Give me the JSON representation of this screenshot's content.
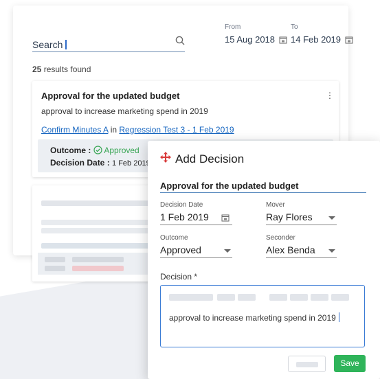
{
  "search": {
    "label": "Search"
  },
  "dates": {
    "from_label": "From",
    "from_value": "15 Aug 2018",
    "to_label": "To",
    "to_value": "14 Feb 2019"
  },
  "results": {
    "count": "25",
    "text": " results found"
  },
  "item": {
    "title": "Approval for the updated budget",
    "description": "approval to increase marketing spend in 2019",
    "link1": "Confirm Minutes A",
    "link_sep": " in ",
    "link2": "Regression Test 3 - 1 Feb 2019",
    "outcome_key": "Outcome : ",
    "outcome_value": "Approved",
    "date_key": "Decision Date : ",
    "date_value": "1 Feb 2019"
  },
  "modal": {
    "title": "Add Decision",
    "field_title": "Approval for the updated budget",
    "decision_date_label": "Decision Date",
    "decision_date_value": "1 Feb 2019",
    "mover_label": "Mover",
    "mover_value": "Ray Flores",
    "outcome_label": "Outcome",
    "outcome_value": "Approved",
    "seconder_label": "Seconder",
    "seconder_value": "Alex Benda",
    "decision_label": "Decision *",
    "decision_text": "approval to increase marketing spend in 2019",
    "save_label": "Save"
  },
  "icons": [
    "search-icon",
    "calendar-icon",
    "check-circle-icon",
    "kebab-menu-icon",
    "move-icon",
    "dropdown-arrow-icon"
  ],
  "colors": {
    "accent": "#2fb45a",
    "link": "#1565c0",
    "brand_red": "#d83a3a",
    "approved": "#3aa655"
  }
}
